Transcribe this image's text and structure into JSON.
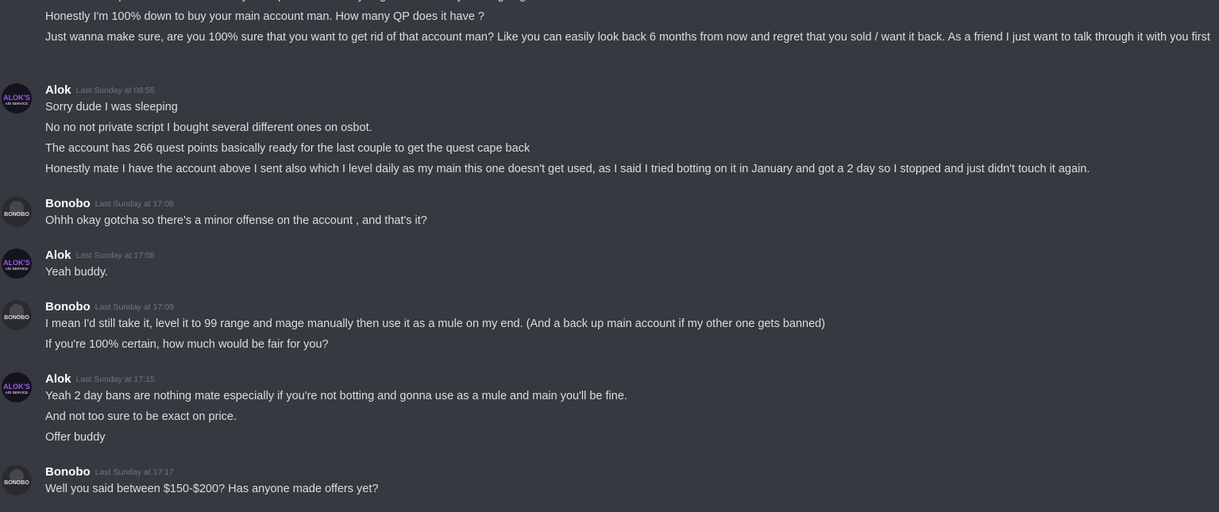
{
  "colors": {
    "background": "#36393f",
    "username": "#ffffff",
    "timestamp": "#72767d",
    "message_text": "#dcddde"
  },
  "top_group": {
    "lines": [
      "Dunn that's expensive - which one did you request ? And are you guaranteed they're not going to mass-sell it later ?",
      "Honestly I'm 100% down to buy your main account man. How many QP does it have ?",
      "Just wanna make sure, are you 100% sure that you want to get rid of that account man? Like you can easily look back 6 months from now and regret that you sold / want it back. As a friend I just want to talk through it with you first"
    ]
  },
  "messages": [
    {
      "author": "Alok",
      "avatar": "aloks-avatar",
      "avatar_text_1": "ALOK'S",
      "avatar_text_2": "A/D SERVICE",
      "timestamp": "Last Sunday at 08:55",
      "lines": [
        "Sorry dude I was sleeping",
        "No no not private script I bought several different ones on osbot.",
        "The account has 266 quest points basically ready for the last couple to get the quest cape back",
        "Honestly mate I have the account above I sent also which I level daily as my main this one doesn't get used, as I said I tried botting on it in January and got a 2 day so I stopped and just didn't touch it again."
      ]
    },
    {
      "author": "Bonobo",
      "avatar": "bonobo-avatar",
      "avatar_text_1": "BONOBO",
      "timestamp": "Last Sunday at 17:08",
      "lines": [
        "Ohhh okay gotcha so there's a minor offense on the account , and that's it?"
      ]
    },
    {
      "author": "Alok",
      "avatar": "aloks-avatar",
      "avatar_text_1": "ALOK'S",
      "avatar_text_2": "A/D SERVICE",
      "timestamp": "Last Sunday at 17:08",
      "lines": [
        "Yeah buddy."
      ]
    },
    {
      "author": "Bonobo",
      "avatar": "bonobo-avatar",
      "avatar_text_1": "BONOBO",
      "timestamp": "Last Sunday at 17:09",
      "lines": [
        "I mean I'd still take it, level it to 99 range and mage manually then use it as a mule on my end. (And a back up main account if my other one gets banned)",
        "If you're 100% certain, how much would be fair for you?"
      ]
    },
    {
      "author": "Alok",
      "avatar": "aloks-avatar",
      "avatar_text_1": "ALOK'S",
      "avatar_text_2": "A/D SERVICE",
      "timestamp": "Last Sunday at 17:15",
      "lines": [
        "Yeah 2 day bans are nothing mate especially if you're not botting and gonna use as a mule and main you'll be fine.",
        "And not too sure to be exact on price.",
        "Offer buddy"
      ]
    },
    {
      "author": "Bonobo",
      "avatar": "bonobo-avatar",
      "avatar_text_1": "BONOBO",
      "timestamp": "Last Sunday at 17:17",
      "lines": [
        "Well you said between $150-$200? Has anyone made offers yet?"
      ]
    }
  ]
}
